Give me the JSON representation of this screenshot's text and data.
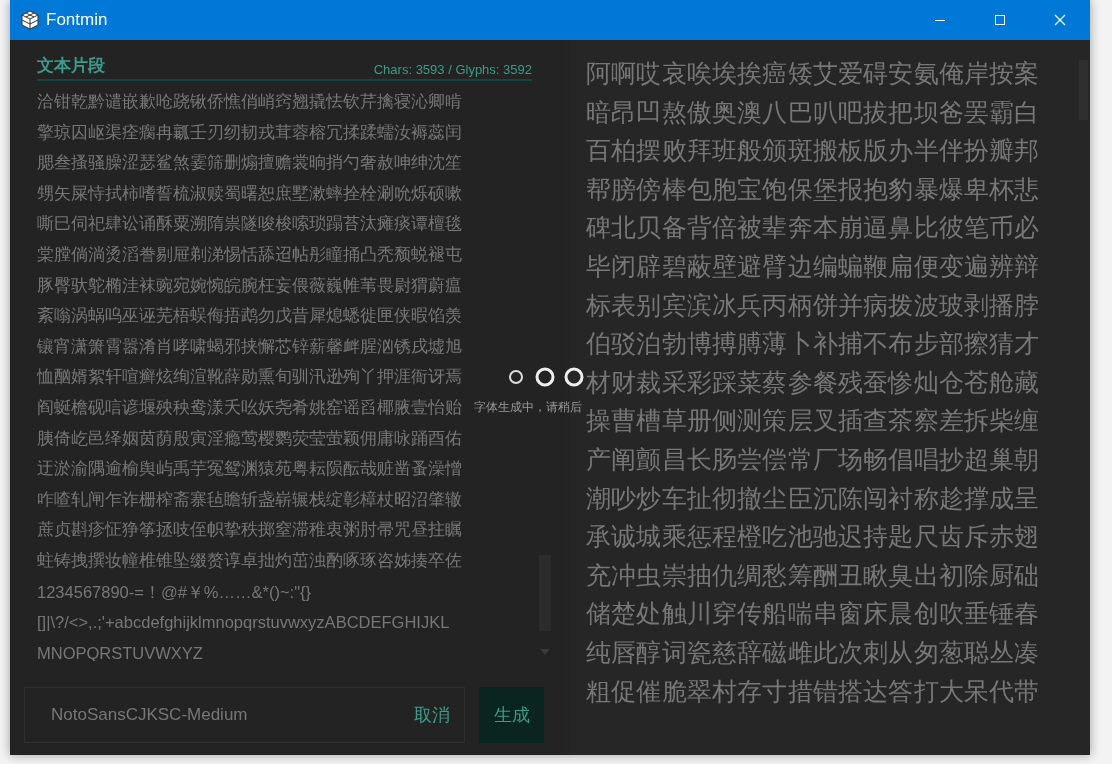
{
  "window": {
    "title": "Fontmin"
  },
  "text_panel": {
    "heading": "文本片段",
    "stats": "Chars: 3593 / Glyphs: 3592",
    "lines": [
      "洽钳乾黔谴嵌歉呛跷锹侨憔俏峭窍翘撬怯钦芹擒寝沁卿啃",
      "擎琼囚岖渠痊瘸冉瓤壬刃纫韧戎茸蓉榕冗揉蹂蠕汝褥蕊闰",
      "腮叁搔骚臊涩瑟鲨煞霎筛删煽擅赡裳晌捎勺奢赦呻绅沈笙",
      "甥矢屎恃拭柿嗜誓梳淑赎蜀曙恕庶墅漱蟀拴栓涮吮烁硕嗽",
      "嘶巳伺祀肆讼诵酥粟溯隋祟隧唆梭嗦琐蹋苔汰瘫痰谭檀毯",
      "棠膛倘淌烫滔誊剔屉剃涕惕恬舔迢帖彤瞳捅凸秃颓蜕褪屯",
      "豚臀驮鸵椭洼袜豌宛婉惋皖腕枉妄偎薇巍帷苇畏尉猬蔚瘟",
      "紊嗡涡蜗呜巫诬芜梧蜈侮捂鹉勿戊昔犀熄蟋徙匣侠暇馅羡",
      "镶宵潇箫霄嚣淆肖哮啸蝎邪挟懈芯锌薪馨衅腥汹锈戌墟旭",
      "恤酗婿絮轩喧癣炫绚渲靴薛勋熏旬驯汛逊殉丫押涯衙讶焉",
      "阎蜒檐砚唁谚堰殃秧鸯漾夭吆妖尧肴姚窑谣舀椰腋壹怡贻",
      "胰倚屹邑绎姻茵荫殷寅淫瘾莺樱鹦荧莹萤颖佣庸咏踊酉佑",
      "迂淤渝隅逾榆舆屿禹芋冤鸳渊猿苑粤耘陨酝哉赃凿蚤澡憎",
      "咋喳轧闸乍诈栅榨斋寨毡瞻斩盏崭辗栈绽彰樟杖昭沼肇辙",
      "蔗贞斟疹怔狰筝拯吱侄帜挚秩掷窒滞稚衷粥肘帚咒昼拄瞩",
      "蛀铸拽撰妆幢椎锥坠缀赘谆卓拙灼茁浊酌啄琢咨姊揍卒佐",
      "1234567890-=！@#￥%……&*()~:\"{}",
      "[]|\\?/<>,.;'+abcdefghijklmnopqrstuvwxyzABCDEFGHIJKL",
      "MNOPQRSTUVWXYZ"
    ]
  },
  "preview_panel": {
    "lines": [
      "阿啊哎哀唉埃挨癌矮艾爱碍安氨俺岸按案",
      "暗昂凹熬傲奥澳八巴叭吧拔把坝爸罢霸白",
      "百柏摆败拜班般颁斑搬板版办半伴扮瓣邦",
      "帮膀傍棒包胞宝饱保堡报抱豹暴爆卑杯悲",
      "碑北贝备背倍被辈奔本崩逼鼻比彼笔币必",
      "毕闭辟碧蔽壁避臂边编蝙鞭扁便变遍辨辩",
      "标表别宾滨冰兵丙柄饼并病拨波玻剥播脖",
      "伯驳泊勃博搏膊薄卜补捕不布步部擦猜才",
      "材财裁采彩踩菜蔡参餐残蚕惨灿仓苍舱藏",
      "操曹槽草册侧测策层叉插查茶察差拆柴缠",
      "产阐颤昌长肠尝偿常厂场畅倡唱抄超巢朝",
      "潮吵炒车扯彻撤尘臣沉陈闯衬称趁撑成呈",
      "承诚城乘惩程橙吃池驰迟持匙尺齿斥赤翅",
      "充冲虫崇抽仇绸愁筹酬丑瞅臭出初除厨础",
      "储楚处触川穿传船喘串窗床晨创吹垂锤春",
      "纯唇醇词瓷慈辞磁雌此次刺从匆葱聪丛凑",
      "粗促催脆翠村存寸措错搭达答打大呆代带"
    ]
  },
  "footer": {
    "font_field": {
      "value": "NotoSansCJKSC-Medium"
    },
    "cancel_link": "取消",
    "generate_button": "生成"
  },
  "loading": {
    "visible": true,
    "message": "字体生成中，请稍后"
  }
}
